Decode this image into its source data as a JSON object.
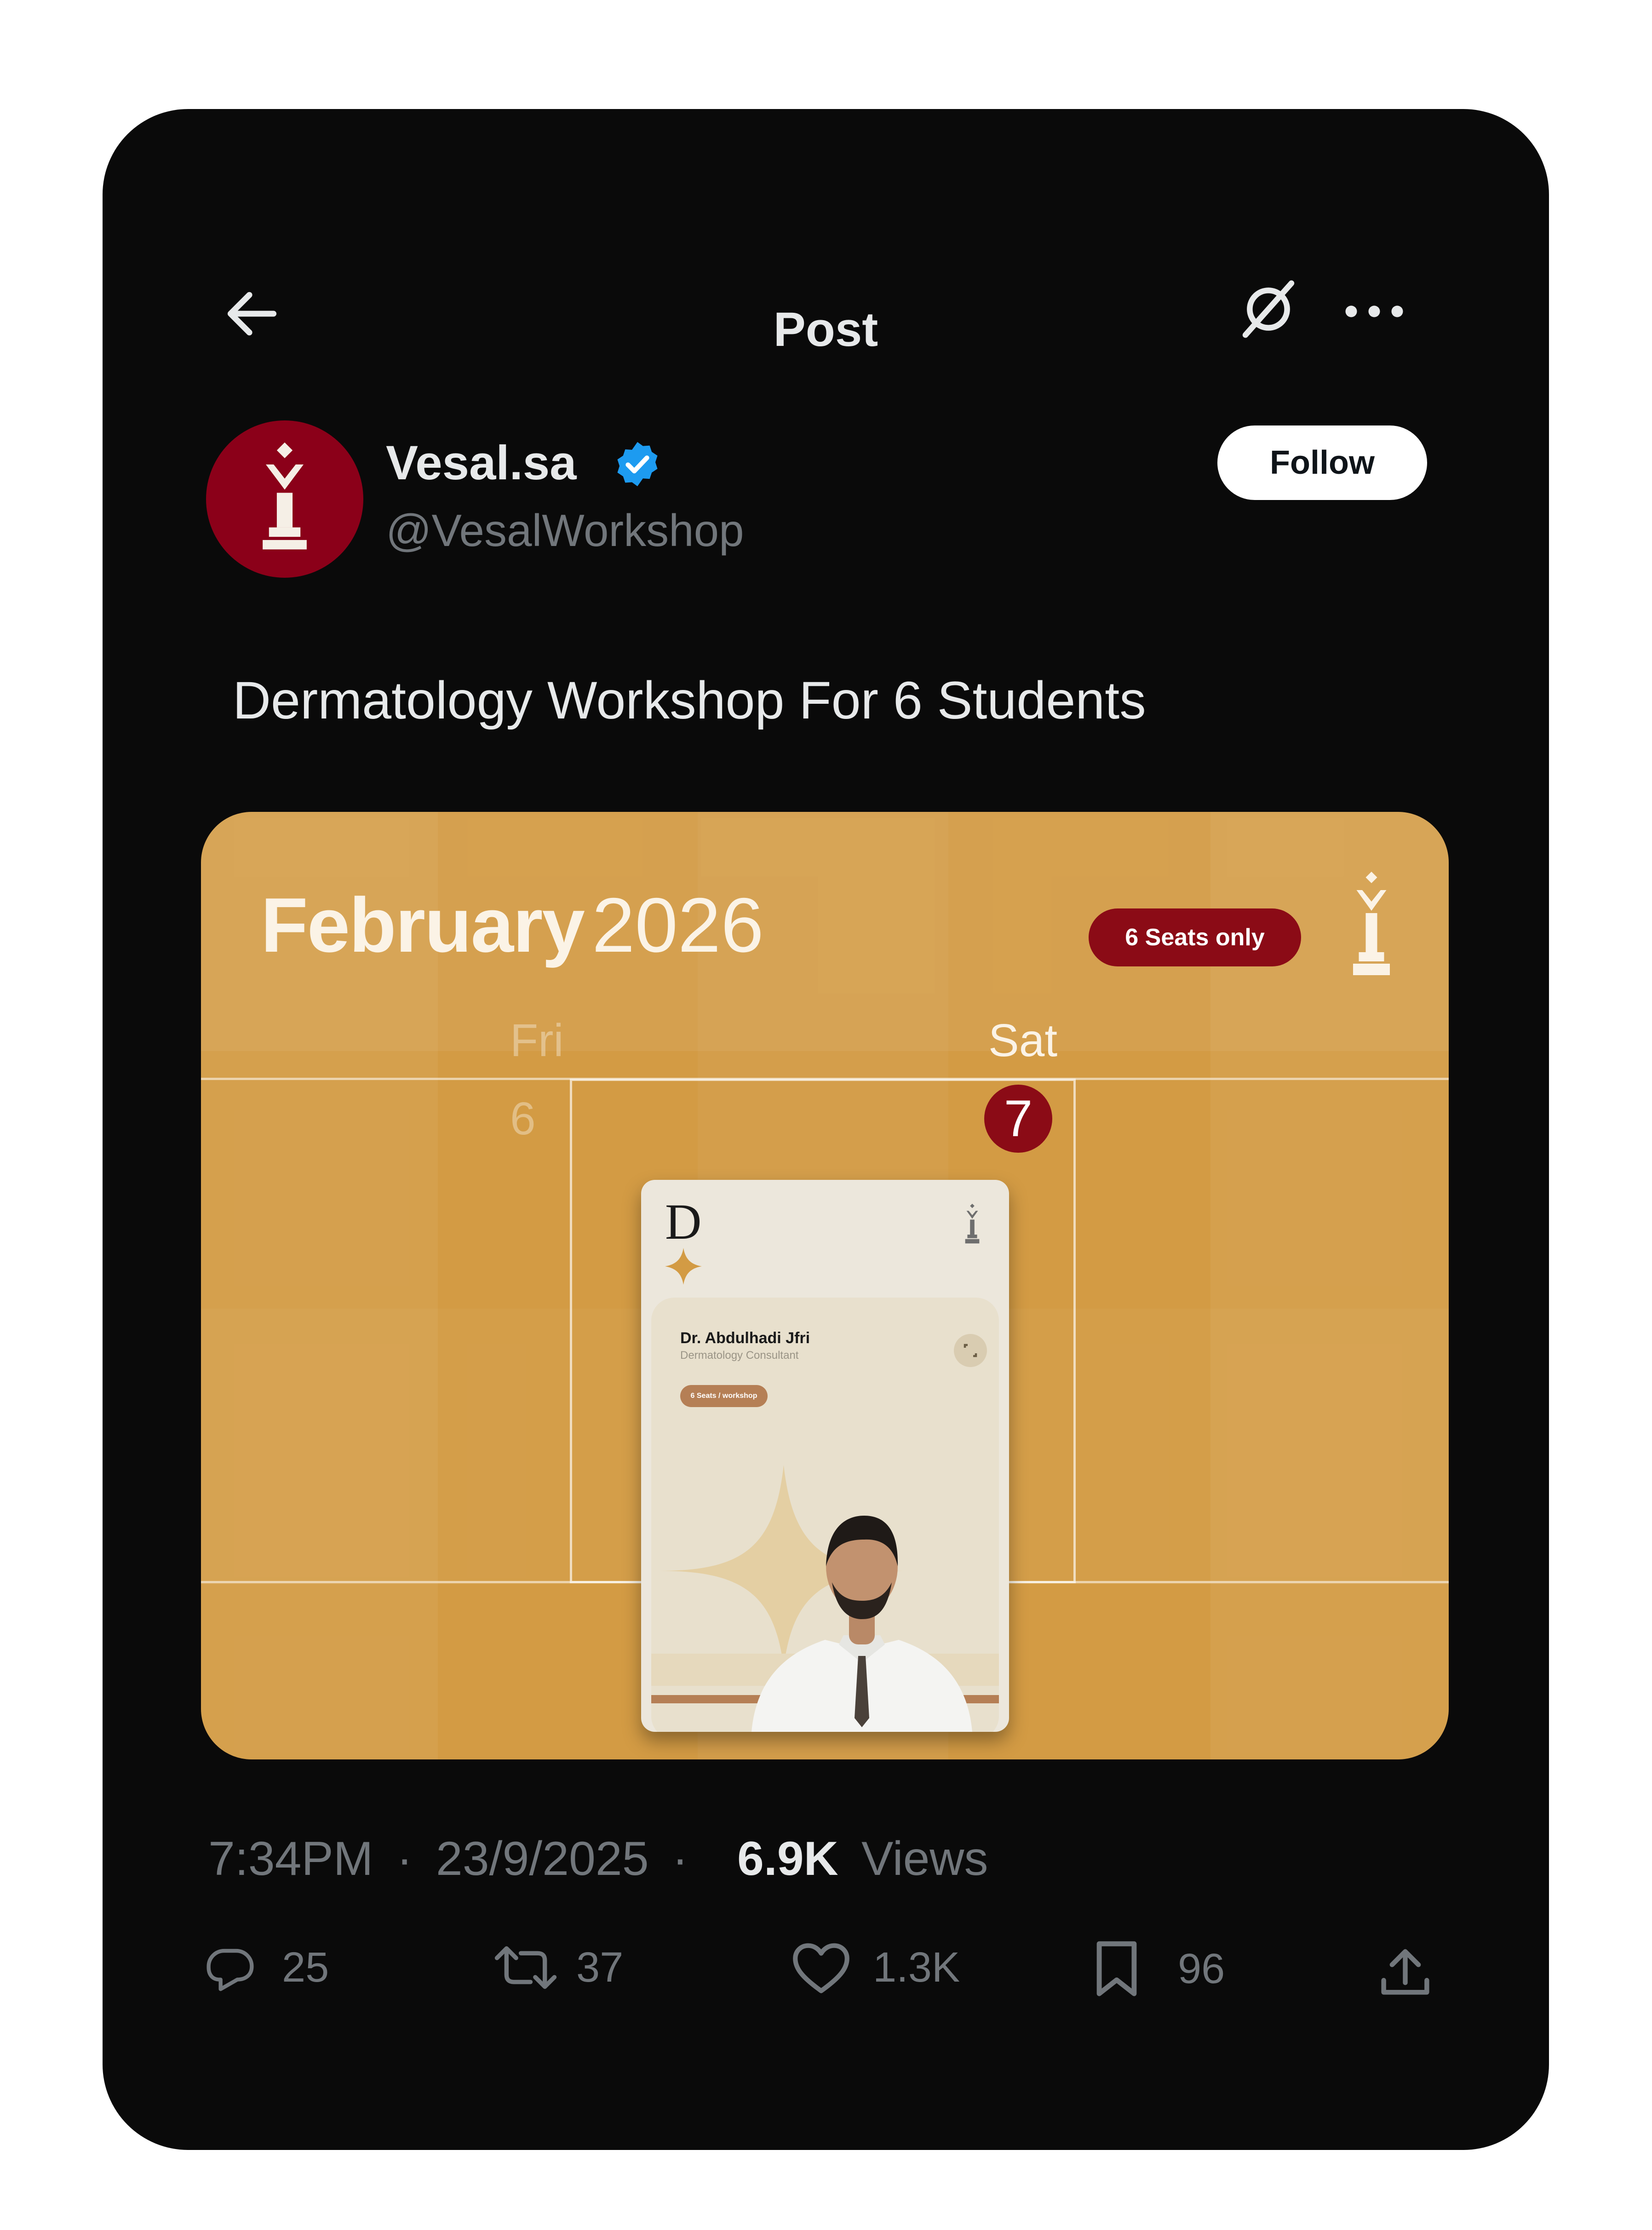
{
  "header": {
    "title": "Post",
    "back_icon": "arrow-left-icon",
    "grok_icon": "grok-icon",
    "more_icon": "more-dots-icon"
  },
  "author": {
    "name": "Vesal.sa",
    "handle": "@VesalWorkshop",
    "verified": true,
    "verified_color": "#1d9bf0",
    "avatar_color": "#8b0019",
    "follow_label": "Follow"
  },
  "post": {
    "text": "Dermatology Workshop For 6 Students"
  },
  "media": {
    "month": "February",
    "year": "2026",
    "seats_badge": "6 Seats only",
    "day1_name": "Fri",
    "day1_num": "6",
    "day2_name": "Sat",
    "day2_num": "7",
    "poster": {
      "letter": "D",
      "doctor_name": "Dr. Abdulhadi Jfri",
      "doctor_title": "Dermatology Consultant",
      "pill": "6 Seats / workshop"
    },
    "colors": {
      "gold": "#d39b44",
      "maroon": "#8b0b16",
      "cream": "#ece7dc"
    }
  },
  "meta": {
    "time": "7:34PM",
    "date": "23/9/2025",
    "views_count": "6.9K",
    "views_label": "Views",
    "separator": "·"
  },
  "actions": {
    "replies": "25",
    "reposts": "37",
    "likes": "1.3K",
    "bookmarks": "96"
  }
}
